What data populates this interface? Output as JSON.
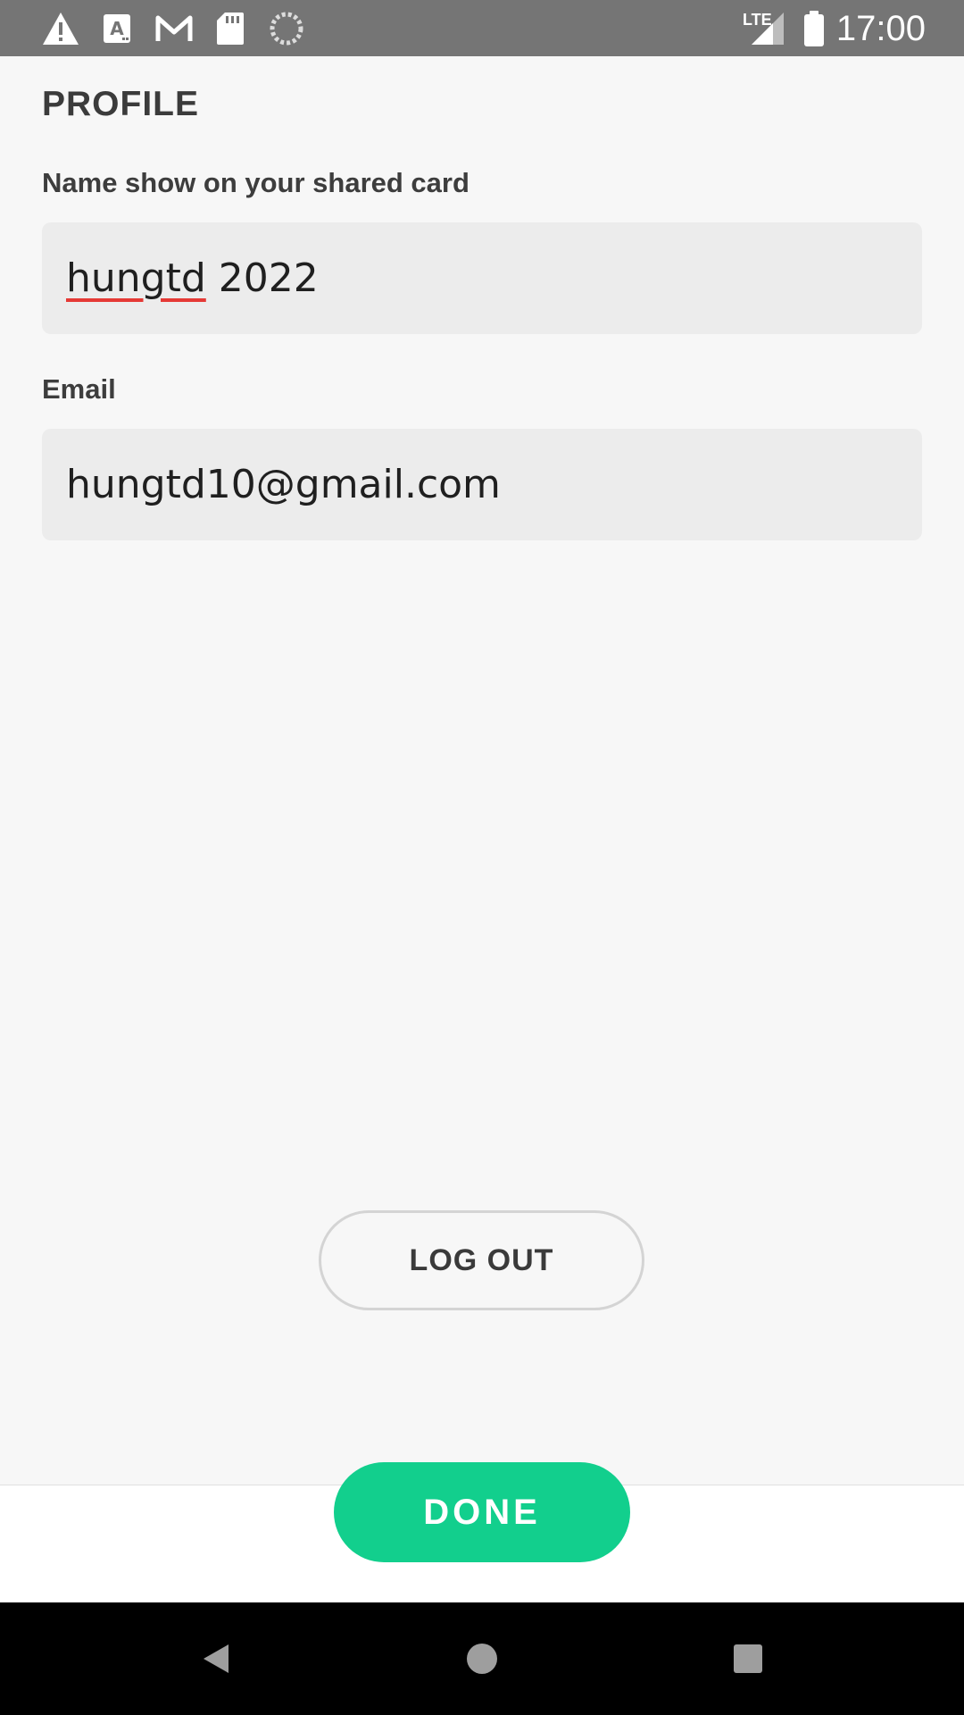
{
  "status_bar": {
    "time": "17:00",
    "network_label": "LTE",
    "icons": [
      "warning-icon",
      "text-a-icon",
      "gmail-icon",
      "sd-card-icon",
      "sync-icon",
      "signal-icon",
      "battery-icon"
    ]
  },
  "profile": {
    "title": "PROFILE",
    "name_label": "Name show on your shared card",
    "name_value_misspelled": "hungtd",
    "name_value_rest": " 2022",
    "email_label": "Email",
    "email_value": "hungtd10@gmail.com"
  },
  "actions": {
    "logout_label": "LOG OUT",
    "done_label": "DONE"
  },
  "colors": {
    "status_bar": "#757575",
    "accent": "#12cf8d",
    "field_bg": "#ececec",
    "spellcheck": "#e53935"
  },
  "nav_bar": {
    "icons": [
      "back-icon",
      "home-icon",
      "recents-icon"
    ]
  }
}
